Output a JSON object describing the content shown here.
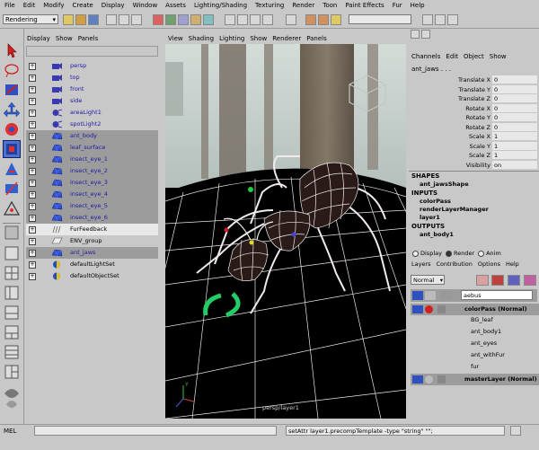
{
  "menubar": [
    "File",
    "Edit",
    "Modify",
    "Create",
    "Display",
    "Window",
    "Assets",
    "Lighting/Shading",
    "Texturing",
    "Render",
    "Toon",
    "Paint Effects",
    "Fur",
    "Help"
  ],
  "statusline": {
    "mode": "Rendering"
  },
  "outliner": {
    "menu": [
      "Display",
      "Show",
      "Panels"
    ],
    "items": [
      {
        "label": "persp",
        "icon": "camera-icon",
        "state": "normal"
      },
      {
        "label": "top",
        "icon": "camera-icon",
        "state": "normal"
      },
      {
        "label": "front",
        "icon": "camera-icon",
        "state": "normal"
      },
      {
        "label": "side",
        "icon": "camera-icon",
        "state": "normal"
      },
      {
        "label": "areaLight1",
        "icon": "light-icon",
        "state": "normal"
      },
      {
        "label": "spotLight2",
        "icon": "light-icon",
        "state": "normal"
      },
      {
        "label": "ant_body",
        "icon": "mesh-icon",
        "state": "sel"
      },
      {
        "label": "leaf_surface",
        "icon": "mesh-icon",
        "state": "sel"
      },
      {
        "label": "insect_eye_1",
        "icon": "mesh-icon",
        "state": "sel"
      },
      {
        "label": "insect_eye_2",
        "icon": "mesh-icon",
        "state": "sel"
      },
      {
        "label": "insect_eye_3",
        "icon": "mesh-icon",
        "state": "sel"
      },
      {
        "label": "insect_eye_4",
        "icon": "mesh-icon",
        "state": "sel"
      },
      {
        "label": "insect_eye_5",
        "icon": "mesh-icon",
        "state": "sel"
      },
      {
        "label": "insect_eye_6",
        "icon": "mesh-icon",
        "state": "sel"
      },
      {
        "label": "FurFeedback",
        "icon": "fur-icon",
        "state": "white"
      },
      {
        "label": "ENV_group",
        "icon": "group-icon",
        "state": "normal"
      },
      {
        "label": "ant_jaws",
        "icon": "mesh-icon",
        "state": "sel"
      },
      {
        "label": "defaultLightSet",
        "icon": "set-icon",
        "state": "normal"
      },
      {
        "label": "defaultObjectSet",
        "icon": "set-icon",
        "state": "normal"
      }
    ]
  },
  "viewport": {
    "menu": [
      "View",
      "Shading",
      "Lighting",
      "Show",
      "Renderer",
      "Panels"
    ],
    "camera_label": "persp/layer1",
    "axis": "Y"
  },
  "channelbox": {
    "tabs": [
      "Channels",
      "Edit",
      "Object",
      "Show"
    ],
    "object": "ant_jaws . . .",
    "attrs": [
      {
        "name": "Translate X",
        "value": "0"
      },
      {
        "name": "Translate Y",
        "value": "0"
      },
      {
        "name": "Translate Z",
        "value": "0"
      },
      {
        "name": "Rotate X",
        "value": "0"
      },
      {
        "name": "Rotate Y",
        "value": "0"
      },
      {
        "name": "Rotate Z",
        "value": "0"
      },
      {
        "name": "Scale X",
        "value": "1"
      },
      {
        "name": "Scale Y",
        "value": "1"
      },
      {
        "name": "Scale Z",
        "value": "1"
      },
      {
        "name": "Visibility",
        "value": "on"
      }
    ],
    "shapes_header": "SHAPES",
    "shapes": [
      "ant_jawsShape"
    ],
    "inputs_header": "INPUTS",
    "inputs": [
      "colorPass",
      "renderLayerManager",
      "layer1"
    ],
    "outputs_header": "OUTPUTS",
    "outputs": [
      "ant_body1"
    ]
  },
  "layereditor": {
    "radio": [
      "Display",
      "Render",
      "Anim"
    ],
    "menu": [
      "Layers",
      "Contribution",
      "Options",
      "Help"
    ],
    "blend_mode": "Normal",
    "search_value": "aebus",
    "rows": [
      {
        "label": "colorPass (Normal)",
        "kind": "layer"
      },
      {
        "label": "BG_leaf",
        "kind": "member"
      },
      {
        "label": "ant_body1",
        "kind": "member"
      },
      {
        "label": "ant_eyes",
        "kind": "member"
      },
      {
        "label": "ant_withFur",
        "kind": "member"
      },
      {
        "label": "fur",
        "kind": "member"
      },
      {
        "label": "masterLayer (Normal)",
        "kind": "layer"
      }
    ]
  },
  "commandline": {
    "label": "MEL",
    "result": "setAttr layer1.precompTemplate -type \"string\" \"\";"
  },
  "colors": {
    "ui_gray": "#c8c8c8",
    "selected": "#9c9c9c",
    "wire": "#f0eaea",
    "jaws": "#22cc66",
    "grid": "#ffffff"
  }
}
